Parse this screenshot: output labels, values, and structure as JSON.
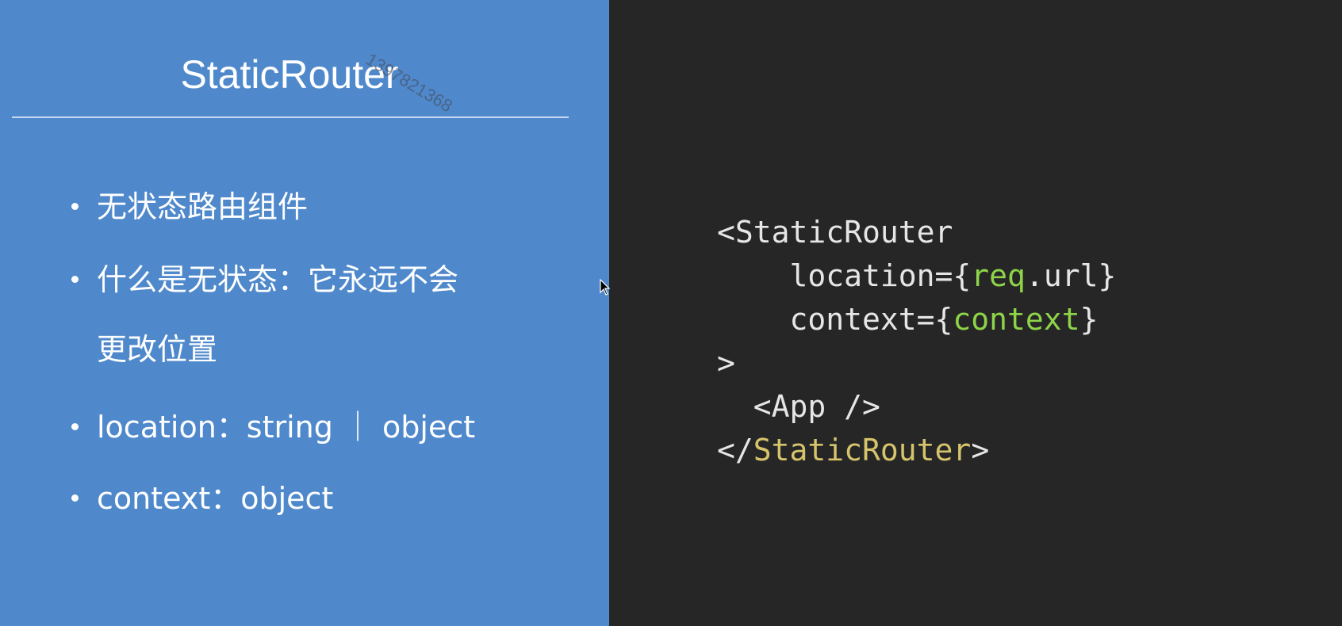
{
  "slide": {
    "title": "StaticRouter",
    "watermark": "1397821368",
    "bullets": [
      {
        "text": "无状态路由组件"
      },
      {
        "line1": "什么是无状态：它永远不会",
        "line2": "更改位置"
      },
      {
        "text": "location：string ｜ object"
      },
      {
        "text": "context：object"
      }
    ]
  },
  "code": {
    "line1_open": "<StaticRouter",
    "line2_indent": "    ",
    "line2_attr": "location={",
    "line2_expr1": "req",
    "line2_expr2": ".url",
    "line2_close": "}",
    "line3_indent": "    ",
    "line3_attr": "context={",
    "line3_expr": "context",
    "line3_close": "}",
    "line4": ">",
    "line5": "  <App />",
    "line6_open": "</",
    "line6_name": "StaticRouter",
    "line6_close": ">"
  },
  "colors": {
    "left_bg": "#4f89cc",
    "right_bg": "#262626",
    "code_green": "#8ed449",
    "code_yellow": "#d6c46c"
  }
}
